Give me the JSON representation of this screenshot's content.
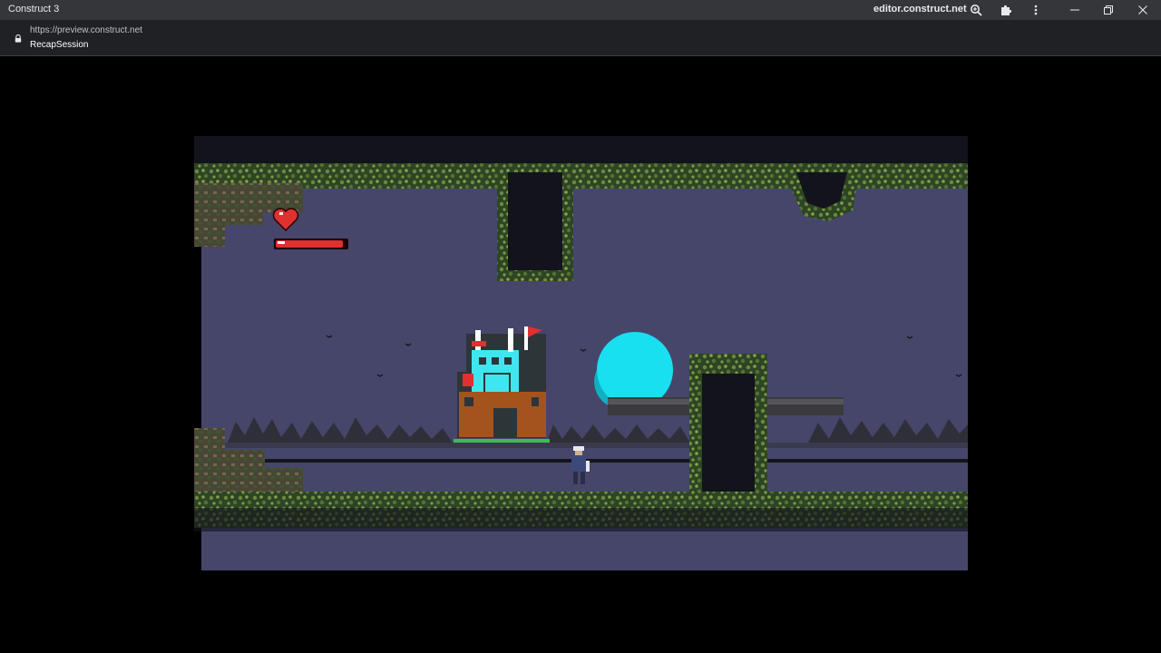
{
  "window": {
    "app_title": "Construct 3",
    "domain": "editor.construct.net"
  },
  "address_bar": {
    "url": "https://preview.construct.net",
    "page_title": "RecapSession"
  },
  "icons": {
    "zoom": "zoom-icon",
    "extensions": "puzzle-icon",
    "menu": "kebab-menu-icon",
    "minimize": "minimize-icon",
    "restore": "restore-icon",
    "close": "close-icon",
    "lock": "lock-icon"
  },
  "game": {
    "player_health": 0.95,
    "colors": {
      "sky": "#46466a",
      "grass": "#6b8a3a",
      "moon": "#18e0f0",
      "health": "#e03030",
      "castle_cyan": "#3ee6f0",
      "castle_brown": "#a5531c"
    }
  }
}
